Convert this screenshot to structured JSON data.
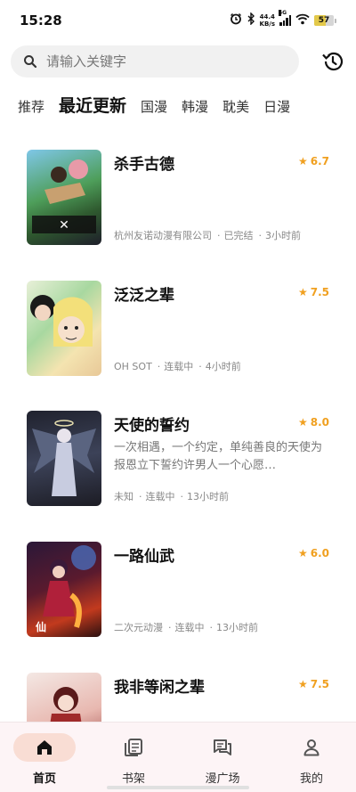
{
  "status_bar": {
    "time": "15:28",
    "net_speed_value": "44.4",
    "net_speed_unit": "KB/s",
    "network": "5G",
    "battery": "57"
  },
  "search": {
    "placeholder": "请输入关键字"
  },
  "tabs": [
    {
      "label": "推荐",
      "active": false
    },
    {
      "label": "最近更新",
      "active": true
    },
    {
      "label": "国漫",
      "active": false
    },
    {
      "label": "韩漫",
      "active": false
    },
    {
      "label": "耽美",
      "active": false
    },
    {
      "label": "日漫",
      "active": false
    }
  ],
  "comics": [
    {
      "title": "杀手古德",
      "rating": "6.7",
      "desc": "",
      "author": "杭州友诺动漫有限公司",
      "status": "已完结",
      "updated": "3小时前"
    },
    {
      "title": "泛泛之辈",
      "rating": "7.5",
      "desc": "",
      "author": "OH SOT",
      "status": "连载中",
      "updated": "4小时前"
    },
    {
      "title": "天使的誓约",
      "rating": "8.0",
      "desc": "一次相遇，一个约定，单纯善良的天使为报恩立下誓约许男人一个心愿…",
      "author": "未知",
      "status": "连载中",
      "updated": "13小时前"
    },
    {
      "title": "一路仙武",
      "rating": "6.0",
      "desc": "",
      "author": "二次元动漫",
      "status": "连载中",
      "updated": "13小时前"
    },
    {
      "title": "我非等闲之辈",
      "rating": "7.5",
      "desc": "",
      "author": "",
      "status": "",
      "updated": ""
    }
  ],
  "bottom_nav": [
    {
      "label": "首页",
      "icon": "home-icon",
      "active": true
    },
    {
      "label": "书架",
      "icon": "bookshelf-icon",
      "active": false
    },
    {
      "label": "漫广场",
      "icon": "chat-icon",
      "active": false
    },
    {
      "label": "我的",
      "icon": "profile-icon",
      "active": false
    }
  ],
  "colors": {
    "accent": "#f0a020",
    "nav_active_bg": "#f9ddd4",
    "nav_bg": "#fdf4f6"
  }
}
